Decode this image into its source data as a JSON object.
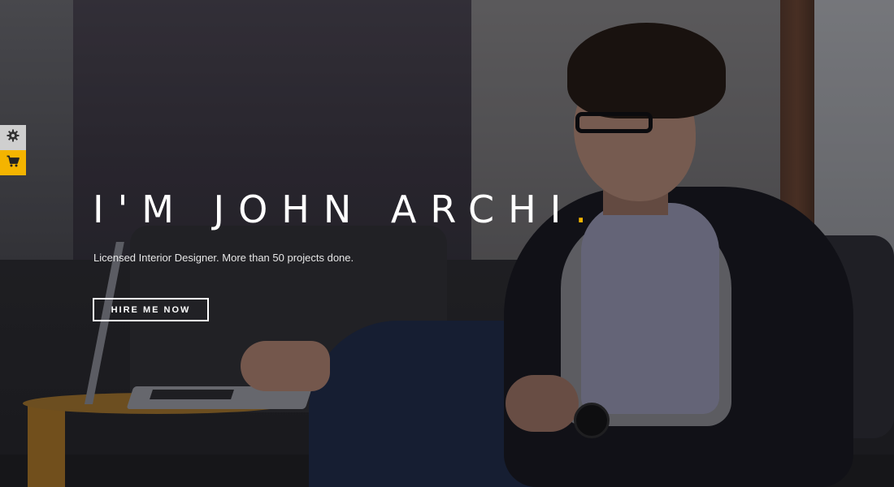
{
  "hero": {
    "title": "I'M JOHN ARCHI",
    "title_accent": ".",
    "subtitle": "Licensed Interior Designer. More than 50 projects done.",
    "cta_label": "HIRE ME NOW"
  },
  "side_toolbar": {
    "items": [
      {
        "icon": "gear-icon"
      },
      {
        "icon": "cart-icon"
      }
    ]
  },
  "colors": {
    "accent": "#f4b400",
    "text": "#ffffff",
    "settings_tab_bg": "#cfcfcf"
  }
}
